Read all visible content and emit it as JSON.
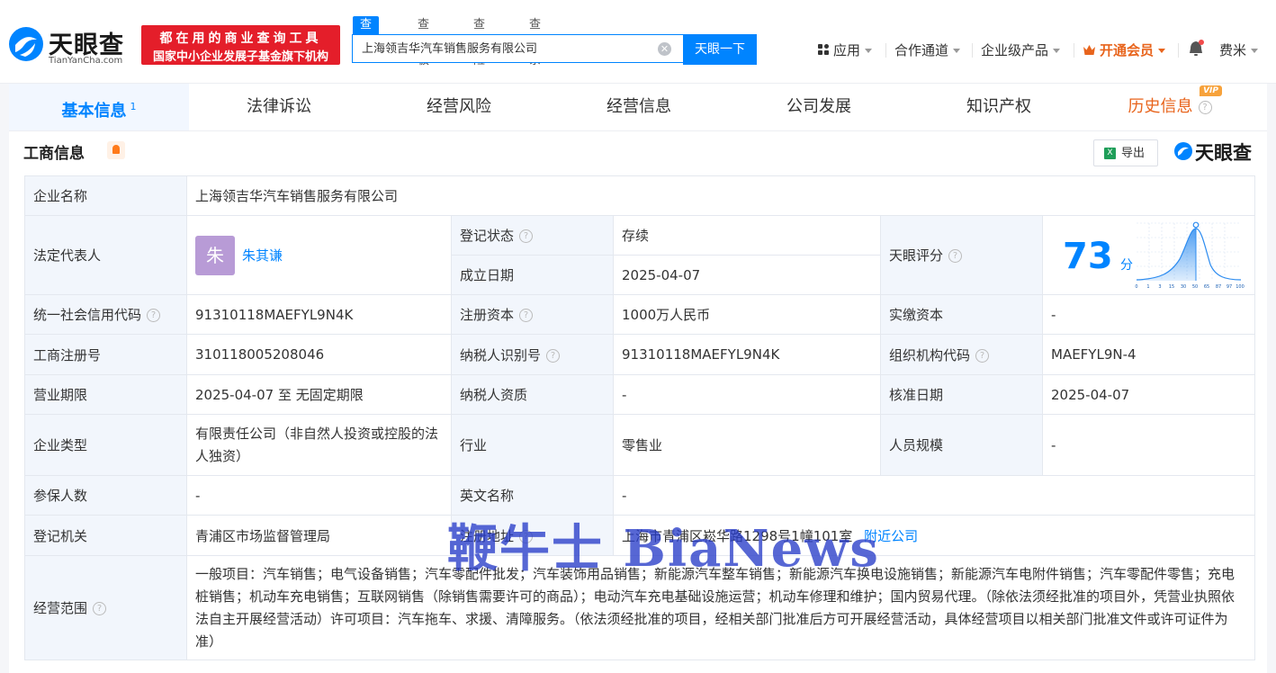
{
  "brand": {
    "name": "天眼查",
    "domain": "TianYanCha.com"
  },
  "slogan": {
    "line1": "都在用的商业查询工具",
    "line2": "国家中小企业发展子基金旗下机构"
  },
  "search": {
    "tabs": [
      "查公司",
      "查老板",
      "查风险",
      "查关系"
    ],
    "value": "上海领吉华汽车销售服务有限公司",
    "button": "天眼一下"
  },
  "nav": {
    "apps": "应用",
    "partner": "合作通道",
    "enterprise": "企业级产品",
    "vip": "开通会员",
    "user": "费米"
  },
  "tabs": {
    "basic": "基本信息",
    "basic_count": "1",
    "legal": "法律诉讼",
    "risk": "经营风险",
    "operation": "经营信息",
    "development": "公司发展",
    "ip": "知识产权",
    "history": "历史信息",
    "vip_tag": "VIP"
  },
  "section": {
    "title": "工商信息",
    "export": "导出",
    "brand": "天眼查"
  },
  "info": {
    "company_name_label": "企业名称",
    "company_name": "上海领吉华汽车销售服务有限公司",
    "legal_rep_label": "法定代表人",
    "legal_rep_avatar": "朱",
    "legal_rep": "朱其谦",
    "reg_status_label": "登记状态",
    "reg_status": "存续",
    "established_label": "成立日期",
    "established": "2025-04-07",
    "score_label": "天眼评分",
    "score": "73",
    "score_unit": "分",
    "score_axis": [
      "0",
      "1",
      "3",
      "15",
      "30",
      "50",
      "65",
      "87",
      "97",
      "100"
    ],
    "credit_code_label": "统一社会信用代码",
    "credit_code": "91310118MAEFYL9N4K",
    "reg_capital_label": "注册资本",
    "reg_capital": "1000万人民币",
    "paid_capital_label": "实缴资本",
    "paid_capital": "-",
    "reg_no_label": "工商注册号",
    "reg_no": "310118005208046",
    "taxpayer_id_label": "纳税人识别号",
    "taxpayer_id": "91310118MAEFYL9N4K",
    "org_code_label": "组织机构代码",
    "org_code": "MAEFYL9N-4",
    "term_label": "营业期限",
    "term": "2025-04-07 至 无固定期限",
    "taxpayer_qual_label": "纳税人资质",
    "taxpayer_qual": "-",
    "approval_date_label": "核准日期",
    "approval_date": "2025-04-07",
    "type_label": "企业类型",
    "type": "有限责任公司（非自然人投资或控股的法人独资）",
    "industry_label": "行业",
    "industry": "零售业",
    "staff_label": "人员规模",
    "staff": "-",
    "insured_label": "参保人数",
    "insured": "-",
    "english_name_label": "英文名称",
    "english_name": "-",
    "authority_label": "登记机关",
    "authority": "青浦区市场监督管理局",
    "address_label": "注册地址",
    "address": "上海市青浦区崧华路1298号1幢101室",
    "nearby": "附近公司",
    "scope_label": "经营范围",
    "scope": "一般项目：汽车销售；电气设备销售；汽车零配件批发；汽车装饰用品销售；新能源汽车整车销售；新能源汽车换电设施销售；新能源汽车电附件销售；汽车零配件零售；充电桩销售；机动车充电销售；互联网销售（除销售需要许可的商品）；电动汽车充电基础设施运营；机动车修理和维护；国内贸易代理。（除依法须经批准的项目外，凭营业执照依法自主开展经营活动）许可项目：汽车拖车、求援、清障服务。（依法须经批准的项目，经相关部门批准后方可开展经营活动，具体经营项目以相关部门批准文件或许可证件为准）"
  },
  "watermark": "鞭牛士 BiaNews",
  "colors": {
    "primary": "#0084ff",
    "vip": "#e8641c",
    "slogan_bg": "#e41e2a",
    "status_green": "#19a15f"
  }
}
